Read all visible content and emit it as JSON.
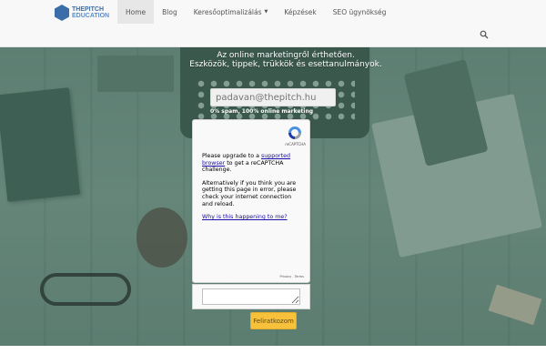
{
  "brand": {
    "name_line1": "THEPITCH",
    "name_line2": "EDUCATION",
    "accent": "#3b6ea8"
  },
  "nav": {
    "items": [
      {
        "label": "Home",
        "active": true
      },
      {
        "label": "Blog",
        "active": false
      },
      {
        "label": "Keresőoptimalizálás",
        "active": false,
        "dropdown": true
      },
      {
        "label": "Képzések",
        "active": false
      },
      {
        "label": "SEO ügynökség",
        "active": false
      }
    ],
    "search_icon": "search-icon"
  },
  "hero": {
    "title_line1": "Az online marketingről érthetően.",
    "title_line2": "Eszközök, tippek, trükkök és esettanulmányok.",
    "email_placeholder": "padavan@thepitch.hu",
    "note": "0% spam, 100% online marketing"
  },
  "recaptcha": {
    "label": "reCAPTCHA",
    "msg_prefix": "Please upgrade to a ",
    "msg_link": "supported browser",
    "msg_suffix": " to get a reCAPTCHA challenge.",
    "alt_msg": "Alternatively if you think you are getting this page in error, please check your internet connection and reload.",
    "why_link": "Why is this happening to me?",
    "footer": "Privacy - Terms"
  },
  "subscribe_button": "Feliratkozom",
  "colors": {
    "button": "#f7c13b",
    "nav_bg": "#f8f8f8",
    "hero_tint": "#7c988b"
  }
}
